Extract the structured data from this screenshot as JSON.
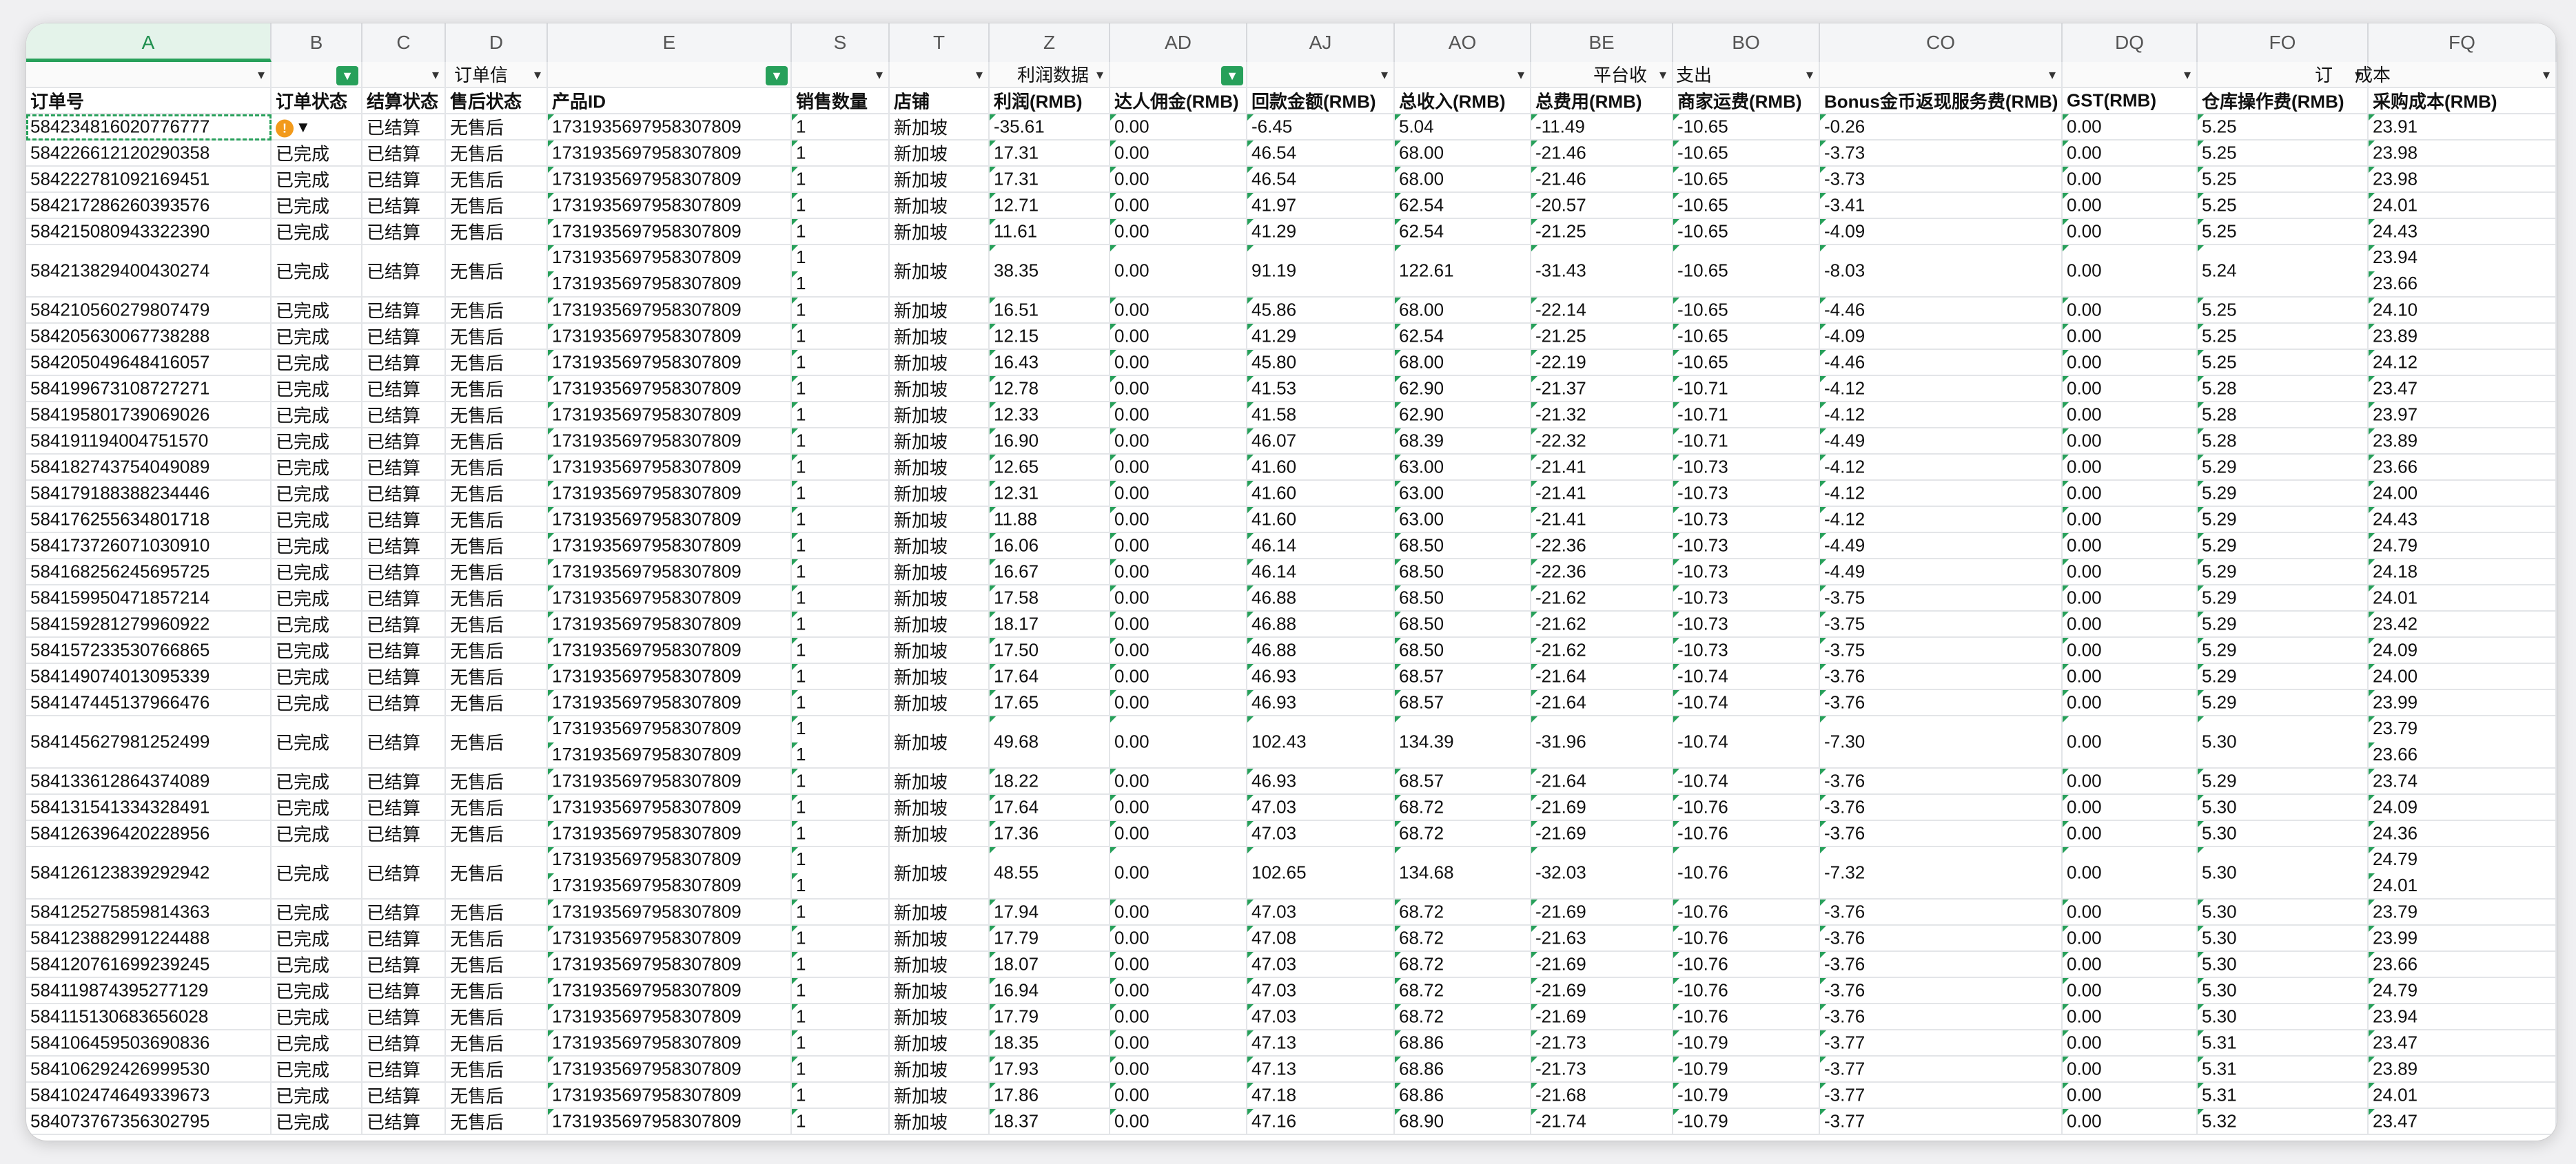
{
  "columns": [
    "A",
    "B",
    "C",
    "D",
    "E",
    "S",
    "T",
    "Z",
    "AD",
    "AJ",
    "AO",
    "BE",
    "BO",
    "CO",
    "DQ",
    "FO",
    "FQ"
  ],
  "selected_column": "A",
  "group_labels": {
    "order_info": "订单信",
    "profit_data": "利润数据",
    "platform_income": "平台收",
    "expense": "支出",
    "order_cost": "订",
    "order_cost_tail": "成本"
  },
  "headers": {
    "A": "订单号",
    "B": "订单状态",
    "C": "结算状态",
    "D": "售后状态",
    "E": "产品ID",
    "S": "销售数量",
    "T": "店铺",
    "Z": "利润(RMB)",
    "AD": "达人佣金(RMB)",
    "AJ": "回款金额(RMB)",
    "AO": "总收入(RMB)",
    "BE": "总费用(RMB)",
    "BO": "商家运费(RMB)",
    "CO": "Bonus金币返现服务费(RMB)",
    "DQ": "GST(RMB)",
    "FO": "仓库操作费(RMB)",
    "FQ": "采购成本(RMB)"
  },
  "rows": [
    {
      "A": "584234816020776777",
      "B": "",
      "C": "已结算",
      "D": "无售后",
      "E": [
        "1731935697958307809"
      ],
      "S": [
        "1"
      ],
      "T": "新加坡",
      "Z": "-35.61",
      "AD": "0.00",
      "AJ": "-6.45",
      "AO": "5.04",
      "BE": "-11.49",
      "BO": "-10.65",
      "CO": "-0.26",
      "DQ": "0.00",
      "FO": "5.25",
      "FQ": [
        "23.91"
      ]
    },
    {
      "A": "584226612120290358",
      "B": "已完成",
      "C": "已结算",
      "D": "无售后",
      "E": [
        "1731935697958307809"
      ],
      "S": [
        "1"
      ],
      "T": "新加坡",
      "Z": "17.31",
      "AD": "0.00",
      "AJ": "46.54",
      "AO": "68.00",
      "BE": "-21.46",
      "BO": "-10.65",
      "CO": "-3.73",
      "DQ": "0.00",
      "FO": "5.25",
      "FQ": [
        "23.98"
      ]
    },
    {
      "A": "584222781092169451",
      "B": "已完成",
      "C": "已结算",
      "D": "无售后",
      "E": [
        "1731935697958307809"
      ],
      "S": [
        "1"
      ],
      "T": "新加坡",
      "Z": "17.31",
      "AD": "0.00",
      "AJ": "46.54",
      "AO": "68.00",
      "BE": "-21.46",
      "BO": "-10.65",
      "CO": "-3.73",
      "DQ": "0.00",
      "FO": "5.25",
      "FQ": [
        "23.98"
      ]
    },
    {
      "A": "584217286260393576",
      "B": "已完成",
      "C": "已结算",
      "D": "无售后",
      "E": [
        "1731935697958307809"
      ],
      "S": [
        "1"
      ],
      "T": "新加坡",
      "Z": "12.71",
      "AD": "0.00",
      "AJ": "41.97",
      "AO": "62.54",
      "BE": "-20.57",
      "BO": "-10.65",
      "CO": "-3.41",
      "DQ": "0.00",
      "FO": "5.25",
      "FQ": [
        "24.01"
      ]
    },
    {
      "A": "584215080943322390",
      "B": "已完成",
      "C": "已结算",
      "D": "无售后",
      "E": [
        "1731935697958307809"
      ],
      "S": [
        "1"
      ],
      "T": "新加坡",
      "Z": "11.61",
      "AD": "0.00",
      "AJ": "41.29",
      "AO": "62.54",
      "BE": "-21.25",
      "BO": "-10.65",
      "CO": "-4.09",
      "DQ": "0.00",
      "FO": "5.25",
      "FQ": [
        "24.43"
      ]
    },
    {
      "A": "584213829400430274",
      "B": "已完成",
      "C": "已结算",
      "D": "无售后",
      "E": [
        "1731935697958307809",
        "1731935697958307809"
      ],
      "S": [
        "1",
        "1"
      ],
      "T": "新加坡",
      "Z": "38.35",
      "AD": "0.00",
      "AJ": "91.19",
      "AO": "122.61",
      "BE": "-31.43",
      "BO": "-10.65",
      "CO": "-8.03",
      "DQ": "0.00",
      "FO": "5.24",
      "FQ": [
        "23.94",
        "23.66"
      ]
    },
    {
      "A": "584210560279807479",
      "B": "已完成",
      "C": "已结算",
      "D": "无售后",
      "E": [
        "1731935697958307809"
      ],
      "S": [
        "1"
      ],
      "T": "新加坡",
      "Z": "16.51",
      "AD": "0.00",
      "AJ": "45.86",
      "AO": "68.00",
      "BE": "-22.14",
      "BO": "-10.65",
      "CO": "-4.46",
      "DQ": "0.00",
      "FO": "5.25",
      "FQ": [
        "24.10"
      ]
    },
    {
      "A": "584205630067738288",
      "B": "已完成",
      "C": "已结算",
      "D": "无售后",
      "E": [
        "1731935697958307809"
      ],
      "S": [
        "1"
      ],
      "T": "新加坡",
      "Z": "12.15",
      "AD": "0.00",
      "AJ": "41.29",
      "AO": "62.54",
      "BE": "-21.25",
      "BO": "-10.65",
      "CO": "-4.09",
      "DQ": "0.00",
      "FO": "5.25",
      "FQ": [
        "23.89"
      ]
    },
    {
      "A": "584205049648416057",
      "B": "已完成",
      "C": "已结算",
      "D": "无售后",
      "E": [
        "1731935697958307809"
      ],
      "S": [
        "1"
      ],
      "T": "新加坡",
      "Z": "16.43",
      "AD": "0.00",
      "AJ": "45.80",
      "AO": "68.00",
      "BE": "-22.19",
      "BO": "-10.65",
      "CO": "-4.46",
      "DQ": "0.00",
      "FO": "5.25",
      "FQ": [
        "24.12"
      ]
    },
    {
      "A": "584199673108727271",
      "B": "已完成",
      "C": "已结算",
      "D": "无售后",
      "E": [
        "1731935697958307809"
      ],
      "S": [
        "1"
      ],
      "T": "新加坡",
      "Z": "12.78",
      "AD": "0.00",
      "AJ": "41.53",
      "AO": "62.90",
      "BE": "-21.37",
      "BO": "-10.71",
      "CO": "-4.12",
      "DQ": "0.00",
      "FO": "5.28",
      "FQ": [
        "23.47"
      ]
    },
    {
      "A": "584195801739069026",
      "B": "已完成",
      "C": "已结算",
      "D": "无售后",
      "E": [
        "1731935697958307809"
      ],
      "S": [
        "1"
      ],
      "T": "新加坡",
      "Z": "12.33",
      "AD": "0.00",
      "AJ": "41.58",
      "AO": "62.90",
      "BE": "-21.32",
      "BO": "-10.71",
      "CO": "-4.12",
      "DQ": "0.00",
      "FO": "5.28",
      "FQ": [
        "23.97"
      ]
    },
    {
      "A": "584191194004751570",
      "B": "已完成",
      "C": "已结算",
      "D": "无售后",
      "E": [
        "1731935697958307809"
      ],
      "S": [
        "1"
      ],
      "T": "新加坡",
      "Z": "16.90",
      "AD": "0.00",
      "AJ": "46.07",
      "AO": "68.39",
      "BE": "-22.32",
      "BO": "-10.71",
      "CO": "-4.49",
      "DQ": "0.00",
      "FO": "5.28",
      "FQ": [
        "23.89"
      ]
    },
    {
      "A": "584182743754049089",
      "B": "已完成",
      "C": "已结算",
      "D": "无售后",
      "E": [
        "1731935697958307809"
      ],
      "S": [
        "1"
      ],
      "T": "新加坡",
      "Z": "12.65",
      "AD": "0.00",
      "AJ": "41.60",
      "AO": "63.00",
      "BE": "-21.41",
      "BO": "-10.73",
      "CO": "-4.12",
      "DQ": "0.00",
      "FO": "5.29",
      "FQ": [
        "23.66"
      ]
    },
    {
      "A": "584179188388234446",
      "B": "已完成",
      "C": "已结算",
      "D": "无售后",
      "E": [
        "1731935697958307809"
      ],
      "S": [
        "1"
      ],
      "T": "新加坡",
      "Z": "12.31",
      "AD": "0.00",
      "AJ": "41.60",
      "AO": "63.00",
      "BE": "-21.41",
      "BO": "-10.73",
      "CO": "-4.12",
      "DQ": "0.00",
      "FO": "5.29",
      "FQ": [
        "24.00"
      ]
    },
    {
      "A": "584176255634801718",
      "B": "已完成",
      "C": "已结算",
      "D": "无售后",
      "E": [
        "1731935697958307809"
      ],
      "S": [
        "1"
      ],
      "T": "新加坡",
      "Z": "11.88",
      "AD": "0.00",
      "AJ": "41.60",
      "AO": "63.00",
      "BE": "-21.41",
      "BO": "-10.73",
      "CO": "-4.12",
      "DQ": "0.00",
      "FO": "5.29",
      "FQ": [
        "24.43"
      ]
    },
    {
      "A": "584173726071030910",
      "B": "已完成",
      "C": "已结算",
      "D": "无售后",
      "E": [
        "1731935697958307809"
      ],
      "S": [
        "1"
      ],
      "T": "新加坡",
      "Z": "16.06",
      "AD": "0.00",
      "AJ": "46.14",
      "AO": "68.50",
      "BE": "-22.36",
      "BO": "-10.73",
      "CO": "-4.49",
      "DQ": "0.00",
      "FO": "5.29",
      "FQ": [
        "24.79"
      ]
    },
    {
      "A": "584168256245695725",
      "B": "已完成",
      "C": "已结算",
      "D": "无售后",
      "E": [
        "1731935697958307809"
      ],
      "S": [
        "1"
      ],
      "T": "新加坡",
      "Z": "16.67",
      "AD": "0.00",
      "AJ": "46.14",
      "AO": "68.50",
      "BE": "-22.36",
      "BO": "-10.73",
      "CO": "-4.49",
      "DQ": "0.00",
      "FO": "5.29",
      "FQ": [
        "24.18"
      ]
    },
    {
      "A": "584159950471857214",
      "B": "已完成",
      "C": "已结算",
      "D": "无售后",
      "E": [
        "1731935697958307809"
      ],
      "S": [
        "1"
      ],
      "T": "新加坡",
      "Z": "17.58",
      "AD": "0.00",
      "AJ": "46.88",
      "AO": "68.50",
      "BE": "-21.62",
      "BO": "-10.73",
      "CO": "-3.75",
      "DQ": "0.00",
      "FO": "5.29",
      "FQ": [
        "24.01"
      ]
    },
    {
      "A": "584159281279960922",
      "B": "已完成",
      "C": "已结算",
      "D": "无售后",
      "E": [
        "1731935697958307809"
      ],
      "S": [
        "1"
      ],
      "T": "新加坡",
      "Z": "18.17",
      "AD": "0.00",
      "AJ": "46.88",
      "AO": "68.50",
      "BE": "-21.62",
      "BO": "-10.73",
      "CO": "-3.75",
      "DQ": "0.00",
      "FO": "5.29",
      "FQ": [
        "23.42"
      ]
    },
    {
      "A": "584157233530766865",
      "B": "已完成",
      "C": "已结算",
      "D": "无售后",
      "E": [
        "1731935697958307809"
      ],
      "S": [
        "1"
      ],
      "T": "新加坡",
      "Z": "17.50",
      "AD": "0.00",
      "AJ": "46.88",
      "AO": "68.50",
      "BE": "-21.62",
      "BO": "-10.73",
      "CO": "-3.75",
      "DQ": "0.00",
      "FO": "5.29",
      "FQ": [
        "24.09"
      ]
    },
    {
      "A": "584149074013095339",
      "B": "已完成",
      "C": "已结算",
      "D": "无售后",
      "E": [
        "1731935697958307809"
      ],
      "S": [
        "1"
      ],
      "T": "新加坡",
      "Z": "17.64",
      "AD": "0.00",
      "AJ": "46.93",
      "AO": "68.57",
      "BE": "-21.64",
      "BO": "-10.74",
      "CO": "-3.76",
      "DQ": "0.00",
      "FO": "5.29",
      "FQ": [
        "24.00"
      ]
    },
    {
      "A": "584147445137966476",
      "B": "已完成",
      "C": "已结算",
      "D": "无售后",
      "E": [
        "1731935697958307809"
      ],
      "S": [
        "1"
      ],
      "T": "新加坡",
      "Z": "17.65",
      "AD": "0.00",
      "AJ": "46.93",
      "AO": "68.57",
      "BE": "-21.64",
      "BO": "-10.74",
      "CO": "-3.76",
      "DQ": "0.00",
      "FO": "5.29",
      "FQ": [
        "23.99"
      ]
    },
    {
      "A": "584145627981252499",
      "B": "已完成",
      "C": "已结算",
      "D": "无售后",
      "E": [
        "1731935697958307809",
        "1731935697958307809"
      ],
      "S": [
        "1",
        "1"
      ],
      "T": "新加坡",
      "Z": "49.68",
      "AD": "0.00",
      "AJ": "102.43",
      "AO": "134.39",
      "BE": "-31.96",
      "BO": "-10.74",
      "CO": "-7.30",
      "DQ": "0.00",
      "FO": "5.30",
      "FQ": [
        "23.79",
        "23.66"
      ]
    },
    {
      "A": "584133612864374089",
      "B": "已完成",
      "C": "已结算",
      "D": "无售后",
      "E": [
        "1731935697958307809"
      ],
      "S": [
        "1"
      ],
      "T": "新加坡",
      "Z": "18.22",
      "AD": "0.00",
      "AJ": "46.93",
      "AO": "68.57",
      "BE": "-21.64",
      "BO": "-10.74",
      "CO": "-3.76",
      "DQ": "0.00",
      "FO": "5.29",
      "FQ": [
        "23.74"
      ]
    },
    {
      "A": "584131541334328491",
      "B": "已完成",
      "C": "已结算",
      "D": "无售后",
      "E": [
        "1731935697958307809"
      ],
      "S": [
        "1"
      ],
      "T": "新加坡",
      "Z": "17.64",
      "AD": "0.00",
      "AJ": "47.03",
      "AO": "68.72",
      "BE": "-21.69",
      "BO": "-10.76",
      "CO": "-3.76",
      "DQ": "0.00",
      "FO": "5.30",
      "FQ": [
        "24.09"
      ]
    },
    {
      "A": "584126396420228956",
      "B": "已完成",
      "C": "已结算",
      "D": "无售后",
      "E": [
        "1731935697958307809"
      ],
      "S": [
        "1"
      ],
      "T": "新加坡",
      "Z": "17.36",
      "AD": "0.00",
      "AJ": "47.03",
      "AO": "68.72",
      "BE": "-21.69",
      "BO": "-10.76",
      "CO": "-3.76",
      "DQ": "0.00",
      "FO": "5.30",
      "FQ": [
        "24.36"
      ]
    },
    {
      "A": "584126123839292942",
      "B": "已完成",
      "C": "已结算",
      "D": "无售后",
      "E": [
        "1731935697958307809",
        "1731935697958307809"
      ],
      "S": [
        "1",
        "1"
      ],
      "T": "新加坡",
      "Z": "48.55",
      "AD": "0.00",
      "AJ": "102.65",
      "AO": "134.68",
      "BE": "-32.03",
      "BO": "-10.76",
      "CO": "-7.32",
      "DQ": "0.00",
      "FO": "5.30",
      "FQ": [
        "24.79",
        "24.01"
      ]
    },
    {
      "A": "584125275859814363",
      "B": "已完成",
      "C": "已结算",
      "D": "无售后",
      "E": [
        "1731935697958307809"
      ],
      "S": [
        "1"
      ],
      "T": "新加坡",
      "Z": "17.94",
      "AD": "0.00",
      "AJ": "47.03",
      "AO": "68.72",
      "BE": "-21.69",
      "BO": "-10.76",
      "CO": "-3.76",
      "DQ": "0.00",
      "FO": "5.30",
      "FQ": [
        "23.79"
      ]
    },
    {
      "A": "584123882991224488",
      "B": "已完成",
      "C": "已结算",
      "D": "无售后",
      "E": [
        "1731935697958307809"
      ],
      "S": [
        "1"
      ],
      "T": "新加坡",
      "Z": "17.79",
      "AD": "0.00",
      "AJ": "47.08",
      "AO": "68.72",
      "BE": "-21.63",
      "BO": "-10.76",
      "CO": "-3.76",
      "DQ": "0.00",
      "FO": "5.30",
      "FQ": [
        "23.99"
      ]
    },
    {
      "A": "584120761699239245",
      "B": "已完成",
      "C": "已结算",
      "D": "无售后",
      "E": [
        "1731935697958307809"
      ],
      "S": [
        "1"
      ],
      "T": "新加坡",
      "Z": "18.07",
      "AD": "0.00",
      "AJ": "47.03",
      "AO": "68.72",
      "BE": "-21.69",
      "BO": "-10.76",
      "CO": "-3.76",
      "DQ": "0.00",
      "FO": "5.30",
      "FQ": [
        "23.66"
      ]
    },
    {
      "A": "584119874395277129",
      "B": "已完成",
      "C": "已结算",
      "D": "无售后",
      "E": [
        "1731935697958307809"
      ],
      "S": [
        "1"
      ],
      "T": "新加坡",
      "Z": "16.94",
      "AD": "0.00",
      "AJ": "47.03",
      "AO": "68.72",
      "BE": "-21.69",
      "BO": "-10.76",
      "CO": "-3.76",
      "DQ": "0.00",
      "FO": "5.30",
      "FQ": [
        "24.79"
      ]
    },
    {
      "A": "584115130683656028",
      "B": "已完成",
      "C": "已结算",
      "D": "无售后",
      "E": [
        "1731935697958307809"
      ],
      "S": [
        "1"
      ],
      "T": "新加坡",
      "Z": "17.79",
      "AD": "0.00",
      "AJ": "47.03",
      "AO": "68.72",
      "BE": "-21.69",
      "BO": "-10.76",
      "CO": "-3.76",
      "DQ": "0.00",
      "FO": "5.30",
      "FQ": [
        "23.94"
      ]
    },
    {
      "A": "584106459503690836",
      "B": "已完成",
      "C": "已结算",
      "D": "无售后",
      "E": [
        "1731935697958307809"
      ],
      "S": [
        "1"
      ],
      "T": "新加坡",
      "Z": "18.35",
      "AD": "0.00",
      "AJ": "47.13",
      "AO": "68.86",
      "BE": "-21.73",
      "BO": "-10.79",
      "CO": "-3.77",
      "DQ": "0.00",
      "FO": "5.31",
      "FQ": [
        "23.47"
      ]
    },
    {
      "A": "584106292426999530",
      "B": "已完成",
      "C": "已结算",
      "D": "无售后",
      "E": [
        "1731935697958307809"
      ],
      "S": [
        "1"
      ],
      "T": "新加坡",
      "Z": "17.93",
      "AD": "0.00",
      "AJ": "47.13",
      "AO": "68.86",
      "BE": "-21.73",
      "BO": "-10.79",
      "CO": "-3.77",
      "DQ": "0.00",
      "FO": "5.31",
      "FQ": [
        "23.89"
      ]
    },
    {
      "A": "584102474649339673",
      "B": "已完成",
      "C": "已结算",
      "D": "无售后",
      "E": [
        "1731935697958307809"
      ],
      "S": [
        "1"
      ],
      "T": "新加坡",
      "Z": "17.86",
      "AD": "0.00",
      "AJ": "47.18",
      "AO": "68.86",
      "BE": "-21.68",
      "BO": "-10.79",
      "CO": "-3.77",
      "DQ": "0.00",
      "FO": "5.31",
      "FQ": [
        "24.01"
      ]
    },
    {
      "A": "584073767356302795",
      "B": "已完成",
      "C": "已结算",
      "D": "无售后",
      "E": [
        "1731935697958307809"
      ],
      "S": [
        "1"
      ],
      "T": "新加坡",
      "Z": "18.37",
      "AD": "0.00",
      "AJ": "47.16",
      "AO": "68.90",
      "BE": "-21.74",
      "BO": "-10.79",
      "CO": "-3.77",
      "DQ": "0.00",
      "FO": "5.32",
      "FQ": [
        "23.47"
      ]
    }
  ]
}
